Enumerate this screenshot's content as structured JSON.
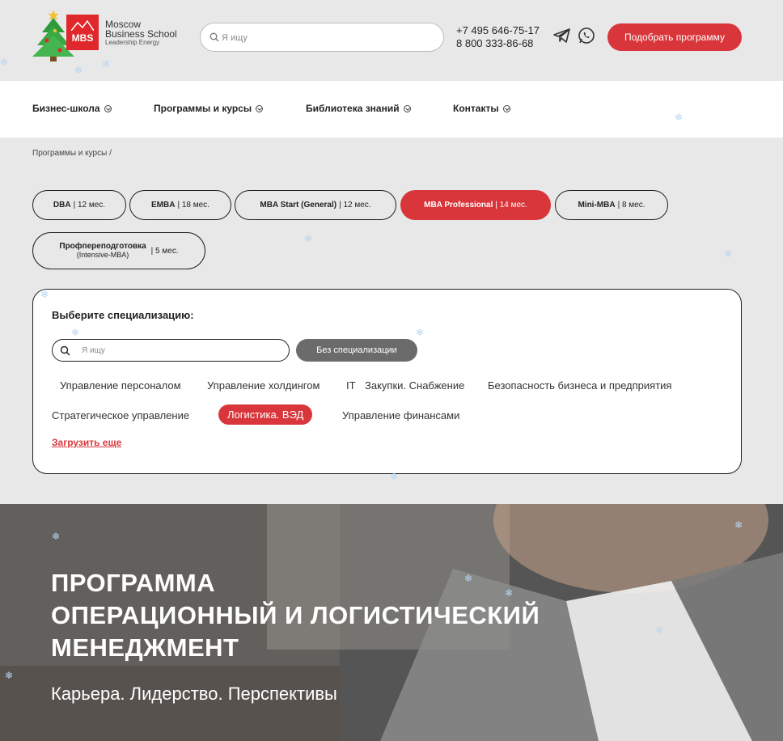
{
  "logo": {
    "brand": "MBS",
    "line1": "Moscow",
    "line2": "Business School",
    "tagline": "Leadership Energy"
  },
  "search": {
    "placeholder": "Я ищу"
  },
  "phones": [
    "+7 495 646-75-17",
    "8 800 333-86-68"
  ],
  "cta_label": "Подобрать программу",
  "nav": [
    {
      "label": "Бизнес-школа"
    },
    {
      "label": "Программы и курсы"
    },
    {
      "label": "Библиотека знаний"
    },
    {
      "label": "Контакты"
    }
  ],
  "breadcrumb": "Программы и курсы /",
  "programs": [
    {
      "name": "DBA",
      "duration": "| 12 мес.",
      "active": false
    },
    {
      "name": "EMBA",
      "duration": "| 18 мес.",
      "active": false
    },
    {
      "name": "MBA Start (General)",
      "duration": "| 12 мес.",
      "active": false
    },
    {
      "name": "MBA Professional",
      "duration": "| 14 мес.",
      "active": true
    },
    {
      "name": "Mini-MBA",
      "duration": "| 8 мес.",
      "active": false
    },
    {
      "name": "Профпереподготовка",
      "sub": "(Intensive-MBA)",
      "duration": "| 5 мес.",
      "active": false
    }
  ],
  "specialization": {
    "title": "Выберите специализацию:",
    "search_placeholder": "Я ищу",
    "no_spec_label": "Без специализации",
    "tags": [
      {
        "label": "Управление персоналом",
        "active": false
      },
      {
        "label": "Управление холдингом",
        "active": false
      },
      {
        "label": "IT",
        "active": false
      },
      {
        "label": "Закупки. Снабжение",
        "active": false
      },
      {
        "label": "Безопасность бизнеса и предприятия",
        "active": false
      },
      {
        "label": "Стратегическое управление",
        "active": false
      },
      {
        "label": "Логистика. ВЭД",
        "active": true
      },
      {
        "label": "Управление финансами",
        "active": false
      }
    ],
    "load_more": "Загрузить еще"
  },
  "hero": {
    "title_lines": [
      "ПРОГРАММА",
      "ОПЕРАЦИОННЫЙ И ЛОГИСТИЧЕСКИЙ",
      "МЕНЕДЖМЕНТ"
    ],
    "subtitle": "Карьера. Лидерство. Перспективы"
  },
  "colors": {
    "accent": "#d9363b",
    "background": "#e8e8e8",
    "gray_button": "#6b6b6b"
  },
  "icons": [
    "search-icon",
    "telegram-icon",
    "whatsapp-icon",
    "chevron-down-icon",
    "christmas-tree-icon",
    "snowflake-icon"
  ]
}
